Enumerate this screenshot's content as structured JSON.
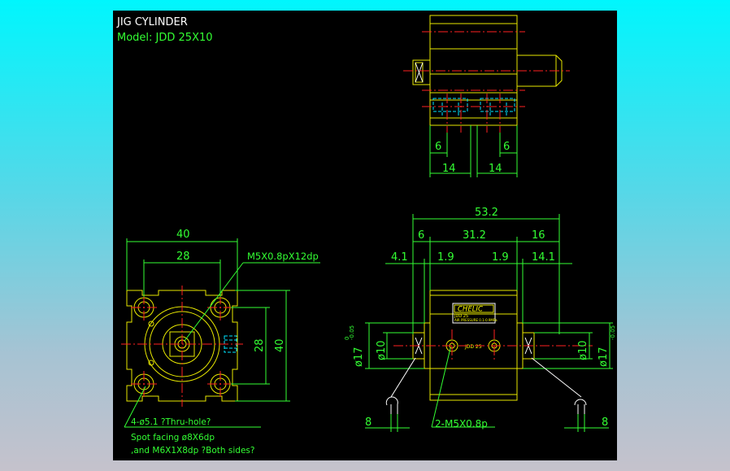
{
  "header": {
    "title": "JIG CYLINDER",
    "model": "Model:  JDD  25X10"
  },
  "top_view": {
    "dims": {
      "left_6": "6",
      "right_6": "6",
      "left_14": "14",
      "right_14": "14"
    }
  },
  "front_view": {
    "dims": {
      "width_40": "40",
      "inner_28": "28",
      "height_28": "28",
      "height_40": "40"
    },
    "thread_callout": "M5X0.8pX12dp",
    "notes": [
      "4-ø5.1 ?Thru-hole?",
      "Spot facing  ø8X6dp",
      ",and M6X1X8dp ?Both sides?"
    ]
  },
  "side_view": {
    "dims": {
      "overall": "53.2",
      "left_6": "6",
      "mid_31_2": "31.2",
      "right_16": "16",
      "left_4_1": "4.1",
      "left_1_9": "1.9",
      "right_1_9": "1.9",
      "right_14_1": "14.1",
      "dia_10_left": "ø10",
      "dia_17_left": "ø17",
      "tol_left": "-0.05",
      "tol_left_top": "0",
      "dia_10_right": "ø10",
      "dia_17_right": "ø17",
      "tol_right": "-0.05",
      "tol_right_top": "0",
      "bottom_left_8": "8",
      "bottom_right_8": "8"
    },
    "port_callout": "2-M5X0.8p",
    "brand": "CHELIC",
    "brand_sub": "JDD 25",
    "label_lines": [
      "JDD 25",
      "AIR PRESSURE 0.1-0.9MPa"
    ],
    "body_mark": "JDD 25"
  }
}
